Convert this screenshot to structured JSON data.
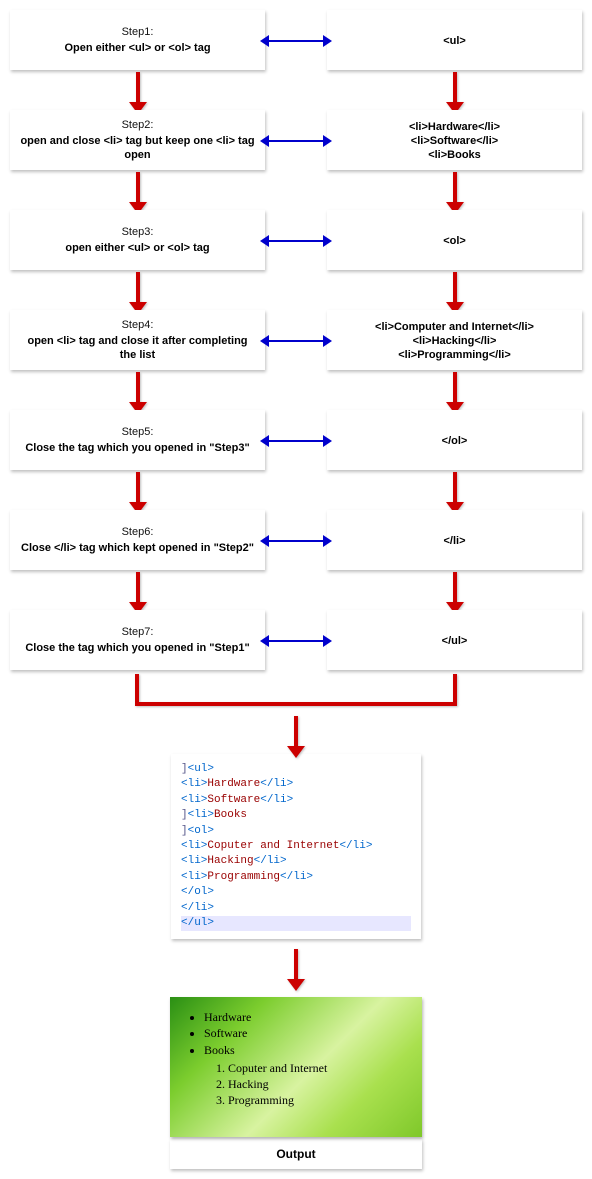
{
  "steps": [
    {
      "label": "Step1:",
      "desc": "Open either <ul> or <ol> tag",
      "code": "<ul>"
    },
    {
      "label": "Step2:",
      "desc": "open and close <li> tag but keep one <li> tag open",
      "code": "<li>Hardware</li>\n<li>Software</li>\n<li>Books"
    },
    {
      "label": "Step3:",
      "desc": "open either <ul> or <ol> tag",
      "code": "<ol>"
    },
    {
      "label": "Step4:",
      "desc": "open  <li> tag and close it after completing the list",
      "code": "<li>Computer and Internet</li>\n<li>Hacking</li>\n<li>Programming</li>"
    },
    {
      "label": "Step5:",
      "desc": "Close the tag which you opened in \"Step3\"",
      "code": "</ol>"
    },
    {
      "label": "Step6:",
      "desc": "Close </li> tag which kept opened in \"Step2\"",
      "code": "</li>"
    },
    {
      "label": "Step7:",
      "desc": "Close the tag which you opened in \"Step1\"",
      "code": "</ul>"
    }
  ],
  "code_lines": [
    {
      "text": "<ul>",
      "cls": "t-blue",
      "pre": "]"
    },
    {
      "text": " <li>Hardware</li>",
      "cls": "mix"
    },
    {
      "text": " <li>Software</li>",
      "cls": "mix"
    },
    {
      "text": "<li>Books",
      "cls": "mix",
      "pre": "]"
    },
    {
      "text": "<ol>",
      "cls": "t-blue",
      "pre": "]"
    },
    {
      "text": " <li>Coputer and Internet</li>",
      "cls": "mix"
    },
    {
      "text": " <li>Hacking</li>",
      "cls": "mix"
    },
    {
      "text": " <li>Programming</li>",
      "cls": "mix"
    },
    {
      "text": " </ol>",
      "cls": "t-blue"
    },
    {
      "text": " </li>",
      "cls": "t-blue"
    },
    {
      "text": "</ul>",
      "cls": "t-blue",
      "hl": true
    }
  ],
  "output": {
    "bullets": [
      "Hardware",
      "Software",
      "Books"
    ],
    "numbered": [
      "Coputer and Internet",
      "Hacking",
      "Programming"
    ],
    "label": "Output"
  }
}
